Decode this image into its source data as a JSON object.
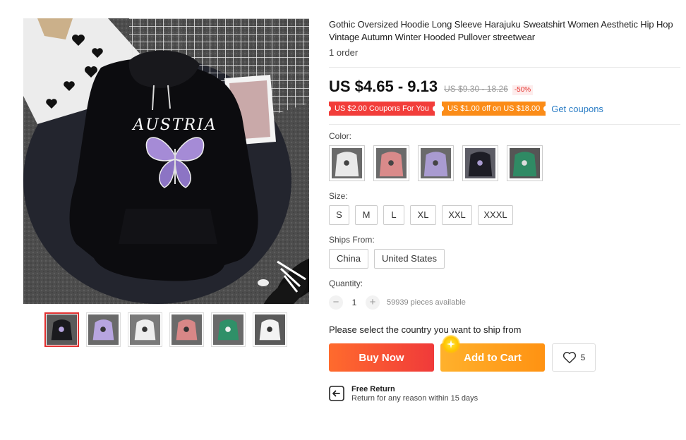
{
  "product": {
    "title": "Gothic Oversized Hoodie Long Sleeve Harajuku Sweatshirt Women Aesthetic Hip Hop Vintage Autumn Winter Hooded Pullover streetwear",
    "orders": "1 order",
    "price": "US $4.65 - 9.13",
    "original_price": "US $9.30 - 18.26",
    "discount": "-50%",
    "print_text": "AUSTRIA"
  },
  "coupons": {
    "coupon1": "US $2.00 Coupons For You",
    "coupon2": "US $1.00 off on US $18.00",
    "get_coupons": "Get coupons"
  },
  "color": {
    "label": "Color:",
    "options": [
      {
        "name": "white",
        "hex": "#e9e9e9"
      },
      {
        "name": "pink",
        "hex": "#d98a8a"
      },
      {
        "name": "purple",
        "hex": "#a99bd0"
      },
      {
        "name": "black",
        "hex": "#1d1d25"
      },
      {
        "name": "green",
        "hex": "#2f8a64"
      }
    ]
  },
  "size": {
    "label": "Size:",
    "options": [
      "S",
      "M",
      "L",
      "XL",
      "XXL",
      "XXXL"
    ]
  },
  "ships_from": {
    "label": "Ships From:",
    "options": [
      "China",
      "United States"
    ]
  },
  "quantity": {
    "label": "Quantity:",
    "minus": "−",
    "value": "1",
    "plus": "+",
    "available": "59939 pieces available"
  },
  "ship_message": "Please select the country you want to ship from",
  "actions": {
    "buy_now": "Buy Now",
    "add_to_cart": "Add to Cart",
    "wishlist_count": "5"
  },
  "free_return": {
    "title": "Free Return",
    "subtitle": "Return for any reason within 15 days"
  },
  "gallery": {
    "thumbnails": [
      {
        "name": "black",
        "hex": "#1a1a1e",
        "bg": "#5a5a5a",
        "active": true
      },
      {
        "name": "purple",
        "hex": "#b7a5e0",
        "bg": "#6a6a6a",
        "active": false
      },
      {
        "name": "white",
        "hex": "#eeeeee",
        "bg": "#7a7a7a",
        "active": false
      },
      {
        "name": "pink",
        "hex": "#d88787",
        "bg": "#6a6a6a",
        "active": false
      },
      {
        "name": "green",
        "hex": "#2f9068",
        "bg": "#6a6a6a",
        "active": false
      },
      {
        "name": "white-2",
        "hex": "#f3f3f3",
        "bg": "#5a5a5a",
        "active": false
      }
    ]
  }
}
